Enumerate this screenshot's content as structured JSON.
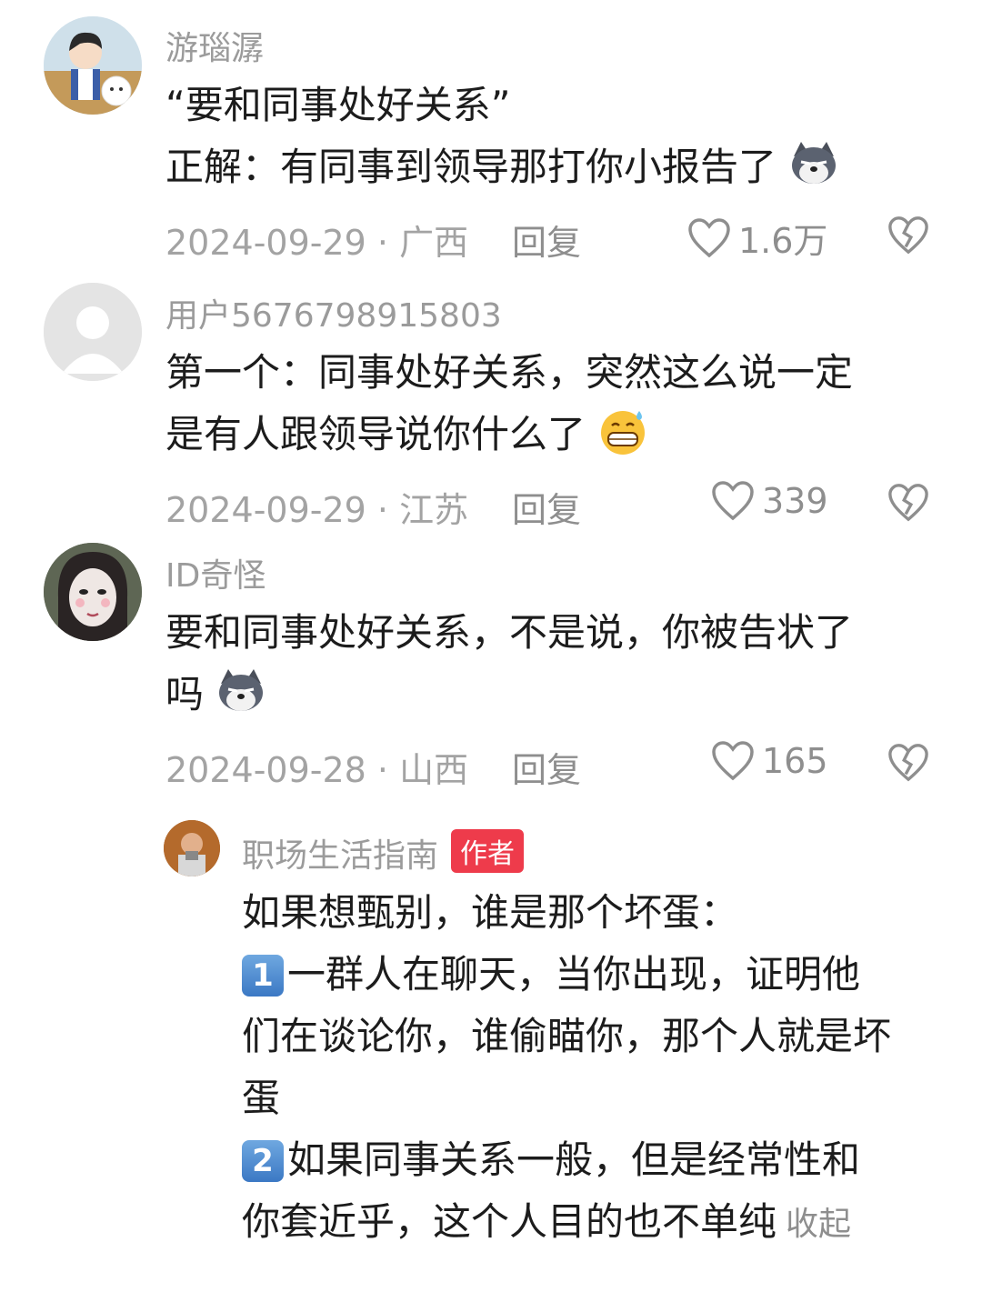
{
  "comments": [
    {
      "username": "游瑙潺",
      "lines": [
        "“要和同事处好关系”",
        "正解：有同事到领导那打你小报告了"
      ],
      "date_location": "2024-09-29 · 广西",
      "reply_label": "回复",
      "likes": "1.6万"
    },
    {
      "username": "用户5676798915803",
      "lines": [
        "第一个：同事处好关系，突然这么说一定",
        "是有人跟领导说你什么了"
      ],
      "date_location": "2024-09-29 · 江苏",
      "reply_label": "回复",
      "likes": "339"
    },
    {
      "username": "ID奇怪",
      "lines": [
        "要和同事处好关系，不是说，你被告状了",
        "吗"
      ],
      "date_location": "2024-09-28 · 山西",
      "reply_label": "回复",
      "likes": "165"
    }
  ],
  "reply": {
    "username": "职场生活指南",
    "author_badge": "作者",
    "line1": "如果想甄别，谁是那个坏蛋：",
    "item1_num": "1",
    "item1_line1": "一群人在聊天，当你出现，证明他",
    "item1_line2": "们在谈论你，谁偷瞄你，那个人就是坏",
    "item1_line3": "蛋",
    "item2_num": "2",
    "item2_line1": "如果同事关系一般，但是经常性和",
    "item2_line2": "你套近乎，这个人目的也不单纯",
    "collapse_label": "收起"
  },
  "colors": {
    "author_badge": "#ee3b4b",
    "meta_gray": "#a3a3a3"
  }
}
